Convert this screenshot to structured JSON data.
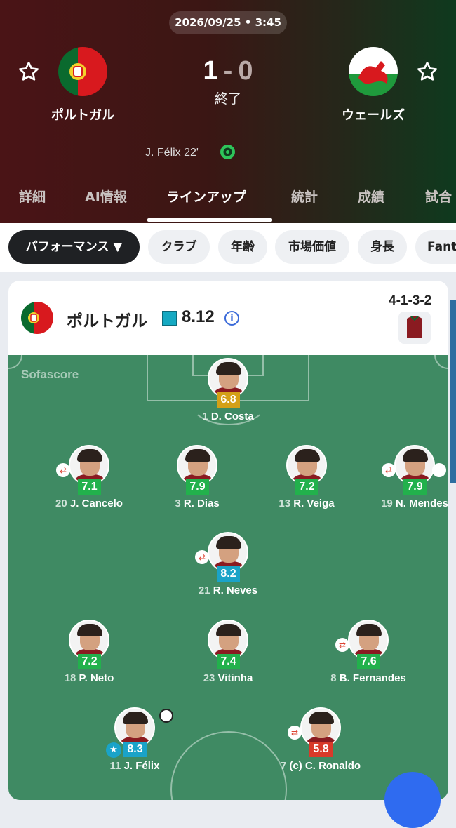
{
  "match": {
    "datetime": "2026/09/25 • 3:45",
    "home": {
      "name": "ポルトガル",
      "score": "1"
    },
    "away": {
      "name": "ウェールズ",
      "score": "0"
    },
    "score_separator": "-",
    "status": "終了",
    "goals": [
      "J. Félix 22'"
    ]
  },
  "tabs": [
    "詳細",
    "AI情報",
    "ラインアップ",
    "統計",
    "成績",
    "試合"
  ],
  "active_tab": "ラインアップ",
  "filters": [
    "パフォーマンス ▼",
    "クラブ",
    "年齢",
    "市場価値",
    "身長",
    "Fanta"
  ],
  "active_filter": "パフォーマンス ▼",
  "lineup": {
    "team": "ポルトガル",
    "team_rating": "8.12",
    "formation": "4-1-3-2",
    "watermark": "Sofascore",
    "players": [
      {
        "number": "1",
        "name": "D. Costa",
        "rating": "6.8",
        "rating_color": "#d4a017"
      },
      {
        "number": "20",
        "name": "J. Cancelo",
        "rating": "7.1",
        "rating_color": "#22b14c"
      },
      {
        "number": "3",
        "name": "R. Dias",
        "rating": "7.9",
        "rating_color": "#22b14c"
      },
      {
        "number": "13",
        "name": "R. Veiga",
        "rating": "7.2",
        "rating_color": "#22b14c"
      },
      {
        "number": "19",
        "name": "N. Mendes",
        "rating": "7.9",
        "rating_color": "#22b14c"
      },
      {
        "number": "21",
        "name": "R. Neves",
        "rating": "8.2",
        "rating_color": "#1aa3c8"
      },
      {
        "number": "18",
        "name": "P. Neto",
        "rating": "7.2",
        "rating_color": "#22b14c"
      },
      {
        "number": "23",
        "name": "Vitinha",
        "rating": "7.4",
        "rating_color": "#22b14c"
      },
      {
        "number": "8",
        "name": "B. Fernandes",
        "rating": "7.6",
        "rating_color": "#22b14c"
      },
      {
        "number": "11",
        "name": "J. Félix",
        "rating": "8.3",
        "rating_color": "#1aa3c8"
      },
      {
        "number": "7",
        "name": "(c) C. Ronaldo",
        "rating": "5.8",
        "rating_color": "#d83a2a"
      }
    ]
  },
  "colors": {
    "accent": "#2ec45a",
    "top_rating": "#1aa3c8"
  }
}
